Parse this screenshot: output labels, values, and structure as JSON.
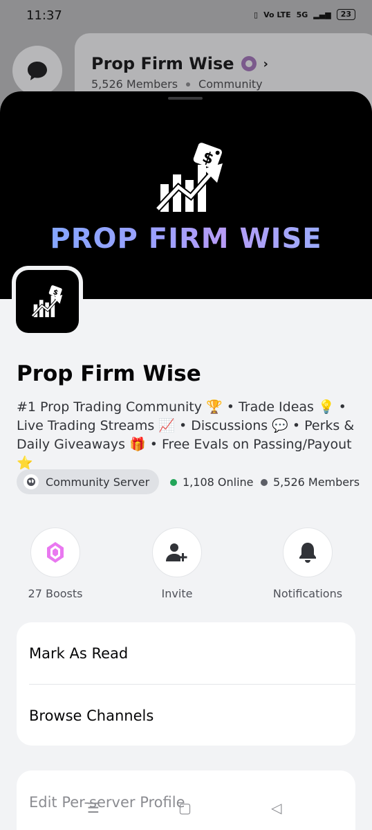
{
  "status_bar": {
    "time": "11:37",
    "network": "Vo LTE",
    "signal": "5G",
    "battery": "23"
  },
  "background": {
    "server_title": "Prop Firm Wise",
    "members": "5,526 Members",
    "type": "Community",
    "chat_icon": "chat-bubble-icon",
    "badge_icon": "verified-flower-icon"
  },
  "banner": {
    "text": "PROP FIRM WISE",
    "logo": "chart-arrow-dollar-tag-icon"
  },
  "server": {
    "name": "Prop Firm Wise",
    "description": "#1 Prop Trading Community 🏆 • Trade Ideas 💡 • Live Trading Streams 📈 • Discussions 💬 • Perks & Daily Giveaways 🎁 • Free Evals on Passing/Payout ⭐",
    "chip_label": "Community Server",
    "online": "1,108 Online",
    "members": "5,526 Members"
  },
  "colors": {
    "online": "#23a559",
    "members": "#5c5e66",
    "boost": "#e978f0"
  },
  "actions": [
    {
      "label": "27 Boosts",
      "icon": "boost-gem-icon"
    },
    {
      "label": "Invite",
      "icon": "add-user-icon"
    },
    {
      "label": "Notifications",
      "icon": "bell-icon"
    }
  ],
  "menu": {
    "mark_as_read": "Mark As Read",
    "browse_channels": "Browse Channels",
    "edit_profile": "Edit Per-server Profile"
  }
}
